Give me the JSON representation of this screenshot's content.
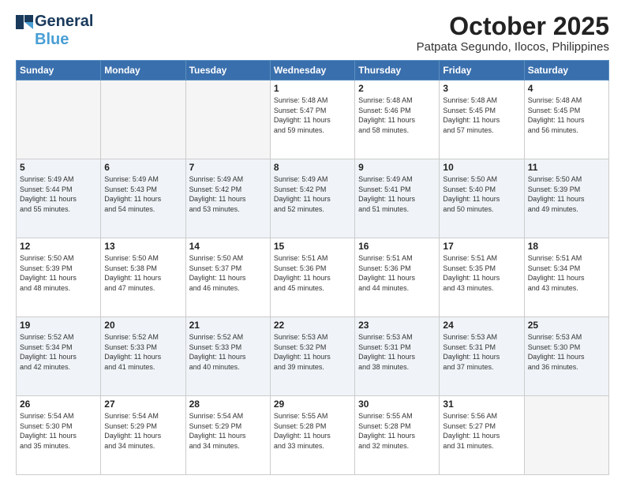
{
  "logo": {
    "line1": "General",
    "line2": "Blue"
  },
  "title": "October 2025",
  "location": "Patpata Segundo, Ilocos, Philippines",
  "weekdays": [
    "Sunday",
    "Monday",
    "Tuesday",
    "Wednesday",
    "Thursday",
    "Friday",
    "Saturday"
  ],
  "weeks": [
    [
      {
        "day": "",
        "empty": true
      },
      {
        "day": "",
        "empty": true
      },
      {
        "day": "",
        "empty": true
      },
      {
        "day": "1",
        "sunrise": "5:48 AM",
        "sunset": "5:47 PM",
        "daylight": "11 hours and 59 minutes."
      },
      {
        "day": "2",
        "sunrise": "5:48 AM",
        "sunset": "5:46 PM",
        "daylight": "11 hours and 58 minutes."
      },
      {
        "day": "3",
        "sunrise": "5:48 AM",
        "sunset": "5:45 PM",
        "daylight": "11 hours and 57 minutes."
      },
      {
        "day": "4",
        "sunrise": "5:48 AM",
        "sunset": "5:45 PM",
        "daylight": "11 hours and 56 minutes."
      }
    ],
    [
      {
        "day": "5",
        "sunrise": "5:49 AM",
        "sunset": "5:44 PM",
        "daylight": "11 hours and 55 minutes."
      },
      {
        "day": "6",
        "sunrise": "5:49 AM",
        "sunset": "5:43 PM",
        "daylight": "11 hours and 54 minutes."
      },
      {
        "day": "7",
        "sunrise": "5:49 AM",
        "sunset": "5:42 PM",
        "daylight": "11 hours and 53 minutes."
      },
      {
        "day": "8",
        "sunrise": "5:49 AM",
        "sunset": "5:42 PM",
        "daylight": "11 hours and 52 minutes."
      },
      {
        "day": "9",
        "sunrise": "5:49 AM",
        "sunset": "5:41 PM",
        "daylight": "11 hours and 51 minutes."
      },
      {
        "day": "10",
        "sunrise": "5:50 AM",
        "sunset": "5:40 PM",
        "daylight": "11 hours and 50 minutes."
      },
      {
        "day": "11",
        "sunrise": "5:50 AM",
        "sunset": "5:39 PM",
        "daylight": "11 hours and 49 minutes."
      }
    ],
    [
      {
        "day": "12",
        "sunrise": "5:50 AM",
        "sunset": "5:39 PM",
        "daylight": "11 hours and 48 minutes."
      },
      {
        "day": "13",
        "sunrise": "5:50 AM",
        "sunset": "5:38 PM",
        "daylight": "11 hours and 47 minutes."
      },
      {
        "day": "14",
        "sunrise": "5:50 AM",
        "sunset": "5:37 PM",
        "daylight": "11 hours and 46 minutes."
      },
      {
        "day": "15",
        "sunrise": "5:51 AM",
        "sunset": "5:36 PM",
        "daylight": "11 hours and 45 minutes."
      },
      {
        "day": "16",
        "sunrise": "5:51 AM",
        "sunset": "5:36 PM",
        "daylight": "11 hours and 44 minutes."
      },
      {
        "day": "17",
        "sunrise": "5:51 AM",
        "sunset": "5:35 PM",
        "daylight": "11 hours and 43 minutes."
      },
      {
        "day": "18",
        "sunrise": "5:51 AM",
        "sunset": "5:34 PM",
        "daylight": "11 hours and 43 minutes."
      }
    ],
    [
      {
        "day": "19",
        "sunrise": "5:52 AM",
        "sunset": "5:34 PM",
        "daylight": "11 hours and 42 minutes."
      },
      {
        "day": "20",
        "sunrise": "5:52 AM",
        "sunset": "5:33 PM",
        "daylight": "11 hours and 41 minutes."
      },
      {
        "day": "21",
        "sunrise": "5:52 AM",
        "sunset": "5:33 PM",
        "daylight": "11 hours and 40 minutes."
      },
      {
        "day": "22",
        "sunrise": "5:53 AM",
        "sunset": "5:32 PM",
        "daylight": "11 hours and 39 minutes."
      },
      {
        "day": "23",
        "sunrise": "5:53 AM",
        "sunset": "5:31 PM",
        "daylight": "11 hours and 38 minutes."
      },
      {
        "day": "24",
        "sunrise": "5:53 AM",
        "sunset": "5:31 PM",
        "daylight": "11 hours and 37 minutes."
      },
      {
        "day": "25",
        "sunrise": "5:53 AM",
        "sunset": "5:30 PM",
        "daylight": "11 hours and 36 minutes."
      }
    ],
    [
      {
        "day": "26",
        "sunrise": "5:54 AM",
        "sunset": "5:30 PM",
        "daylight": "11 hours and 35 minutes."
      },
      {
        "day": "27",
        "sunrise": "5:54 AM",
        "sunset": "5:29 PM",
        "daylight": "11 hours and 34 minutes."
      },
      {
        "day": "28",
        "sunrise": "5:54 AM",
        "sunset": "5:29 PM",
        "daylight": "11 hours and 34 minutes."
      },
      {
        "day": "29",
        "sunrise": "5:55 AM",
        "sunset": "5:28 PM",
        "daylight": "11 hours and 33 minutes."
      },
      {
        "day": "30",
        "sunrise": "5:55 AM",
        "sunset": "5:28 PM",
        "daylight": "11 hours and 32 minutes."
      },
      {
        "day": "31",
        "sunrise": "5:56 AM",
        "sunset": "5:27 PM",
        "daylight": "11 hours and 31 minutes."
      },
      {
        "day": "",
        "empty": true
      }
    ]
  ],
  "labels": {
    "sunrise": "Sunrise:",
    "sunset": "Sunset:",
    "daylight": "Daylight:"
  }
}
